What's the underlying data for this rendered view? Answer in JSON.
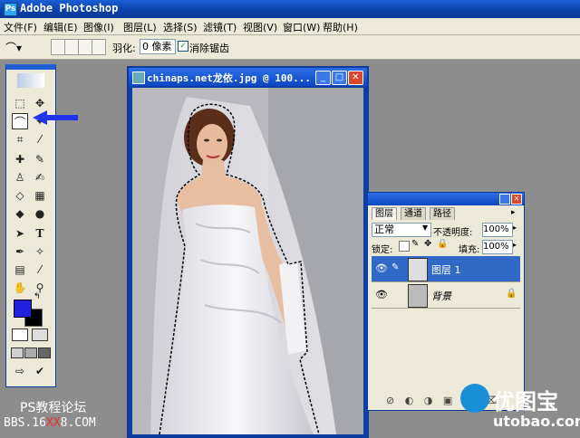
{
  "app": {
    "title": "Adobe Photoshop"
  },
  "menu": {
    "items": [
      "文件(F)",
      "编辑(E)",
      "图像(I)",
      "图层(L)",
      "选择(S)",
      "滤镜(T)",
      "视图(V)",
      "窗口(W)",
      "帮助(H)"
    ]
  },
  "options": {
    "feather_label": "羽化:",
    "feather_value": "0 像素",
    "antialias_label": "消除锯齿",
    "antialias_checked": true
  },
  "document": {
    "title": "chinaps.net龙依.jpg @ 100..."
  },
  "layers_panel": {
    "tabs": [
      "图层",
      "通道",
      "路径"
    ],
    "blend_mode": "正常",
    "opacity_label": "不透明度:",
    "opacity_value": "100%",
    "lock_label": "锁定:",
    "fill_label": "填充:",
    "fill_value": "100%",
    "layers": [
      {
        "name": "图层 1",
        "selected": true
      },
      {
        "name": "背景",
        "selected": false,
        "italic": true
      }
    ]
  },
  "colors": {
    "foreground": "#2222dd",
    "background": "#000000",
    "title_bar": "#0b3fa6",
    "selected_layer": "#3169c6"
  },
  "watermarks": {
    "left_line1": "PS教程论坛",
    "left_line2_a": "BBS.16",
    "left_line2_b": "XX",
    "left_line2_c": "8.COM",
    "right_brand": "优图宝",
    "right_url": "utobao.com"
  }
}
